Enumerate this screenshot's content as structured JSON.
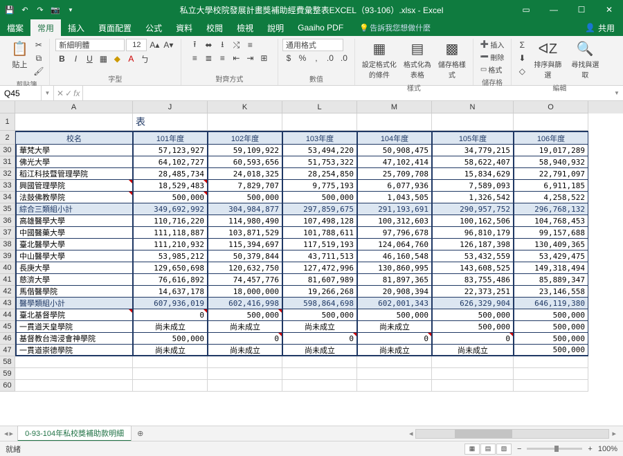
{
  "title": "私立大學校院發展計畫獎補助經費彙整表EXCEL（93-106）.xlsx - Excel",
  "qat": {
    "save": "💾",
    "undo": "↶",
    "redo": "↷",
    "camera": "📷"
  },
  "menu": {
    "items": [
      "檔案",
      "常用",
      "插入",
      "頁面配置",
      "公式",
      "資料",
      "校閱",
      "檢視",
      "說明",
      "Gaaiho PDF"
    ],
    "active": 1,
    "search_icon": "💡",
    "search_hint": "告訴我您想做什麼",
    "share": "共用"
  },
  "ribbon": {
    "clipboard": {
      "paste": "貼上",
      "label": "剪貼簿"
    },
    "font": {
      "name": "新細明體",
      "size": "12",
      "label": "字型"
    },
    "align": {
      "label": "對齊方式",
      "wrap": "≡",
      "merge": "⊞"
    },
    "number": {
      "format": "通用格式",
      "label": "數值"
    },
    "styles": {
      "cond": "設定格式化的條件",
      "table": "格式化為表格",
      "cell": "儲存格樣式",
      "label": "樣式"
    },
    "cells": {
      "insert": "插入",
      "delete": "刪除",
      "format": "格式",
      "label": "儲存格"
    },
    "editing": {
      "sort": "排序與篩選",
      "find": "尋找與選取",
      "sum": "Σ",
      "fill": "⬇",
      "clear": "◇",
      "label": "編輯"
    }
  },
  "namebox": "Q45",
  "fx": "fx",
  "columns": [
    "A",
    "J",
    "K",
    "L",
    "M",
    "N",
    "O"
  ],
  "row_nums": [
    1,
    2,
    30,
    31,
    32,
    33,
    34,
    35,
    36,
    37,
    38,
    39,
    40,
    41,
    42,
    43,
    44,
    45,
    46,
    47,
    58,
    59,
    60
  ],
  "table": {
    "title_suffix": "表",
    "headers": [
      "校名",
      "101年度",
      "102年度",
      "103年度",
      "104年度",
      "105年度",
      "106年度"
    ],
    "rows": [
      {
        "n": "華梵大學",
        "v": [
          "57,123,927",
          "59,109,922",
          "53,494,220",
          "50,908,475",
          "34,779,215",
          "19,017,289"
        ]
      },
      {
        "n": "佛光大學",
        "v": [
          "64,102,727",
          "60,593,656",
          "51,753,322",
          "47,102,414",
          "58,622,407",
          "58,940,932"
        ]
      },
      {
        "n": "稻江科技暨管理學院",
        "v": [
          "28,485,734",
          "24,018,325",
          "28,254,850",
          "25,709,708",
          "15,834,629",
          "22,791,097"
        ]
      },
      {
        "n": "興國管理學院",
        "v": [
          "18,529,483",
          "7,829,707",
          "9,775,193",
          "6,077,936",
          "7,589,093",
          "6,911,185"
        ],
        "tri": [
          0
        ]
      },
      {
        "n": "法鼓佛教學院",
        "v": [
          "500,000",
          "500,000",
          "500,000",
          "1,043,505",
          "1,326,542",
          "4,258,522"
        ],
        "tri": [
          0
        ]
      },
      {
        "n": "綜合三類組小計",
        "v": [
          "349,692,992",
          "304,984,877",
          "297,859,675",
          "291,193,691",
          "290,957,752",
          "296,768,132"
        ],
        "sub": true
      },
      {
        "n": "高雄醫學大學",
        "v": [
          "110,716,220",
          "114,980,490",
          "107,498,128",
          "100,312,603",
          "100,162,506",
          "104,768,453"
        ]
      },
      {
        "n": "中國醫藥大學",
        "v": [
          "111,118,887",
          "103,871,529",
          "101,788,611",
          "97,796,678",
          "96,810,179",
          "99,157,688"
        ]
      },
      {
        "n": "臺北醫學大學",
        "v": [
          "111,210,932",
          "115,394,697",
          "117,519,193",
          "124,064,760",
          "126,187,398",
          "130,409,365"
        ]
      },
      {
        "n": "中山醫學大學",
        "v": [
          "53,985,212",
          "50,379,844",
          "43,711,513",
          "46,160,548",
          "53,432,559",
          "53,429,475"
        ]
      },
      {
        "n": "長庚大學",
        "v": [
          "129,650,698",
          "120,632,750",
          "127,472,996",
          "130,860,995",
          "143,608,525",
          "149,318,494"
        ]
      },
      {
        "n": "慈濟大學",
        "v": [
          "76,616,892",
          "74,457,776",
          "81,607,989",
          "81,897,365",
          "83,755,486",
          "85,889,347"
        ]
      },
      {
        "n": "馬偕醫學院",
        "v": [
          "14,637,178",
          "18,000,000",
          "19,266,268",
          "20,908,394",
          "22,373,251",
          "23,146,558"
        ]
      },
      {
        "n": "醫學類組小計",
        "v": [
          "607,936,019",
          "602,416,998",
          "598,864,698",
          "602,001,343",
          "626,329,904",
          "646,119,380"
        ],
        "sub": true
      },
      {
        "n": "臺北基督學院",
        "v": [
          "0",
          "500,000",
          "500,000",
          "500,000",
          "500,000",
          "500,000"
        ],
        "tri": [
          0,
          1
        ]
      },
      {
        "n": "一貫道天皇學院",
        "v": [
          "尚未成立",
          "尚未成立",
          "尚未成立",
          "尚未成立",
          "500,000",
          "500,000"
        ],
        "txt": [
          0,
          1,
          2,
          3
        ]
      },
      {
        "n": "基督教台灣浸會神學院",
        "v": [
          "500,000",
          "0",
          "0",
          "0",
          "0",
          "500,000"
        ],
        "tri": [
          1,
          2,
          3,
          4
        ]
      },
      {
        "n": "一貫道崇德學院",
        "v": [
          "尚未成立",
          "尚未成立",
          "尚未成立",
          "尚未成立",
          "尚未成立",
          "500,000"
        ],
        "txt": [
          0,
          1,
          2,
          3,
          4
        ]
      }
    ]
  },
  "sheet": {
    "name": "0-93-104年私校獎補助款明細",
    "add": "⊕"
  },
  "status": {
    "ready": "就緒",
    "zoom": "100%"
  }
}
